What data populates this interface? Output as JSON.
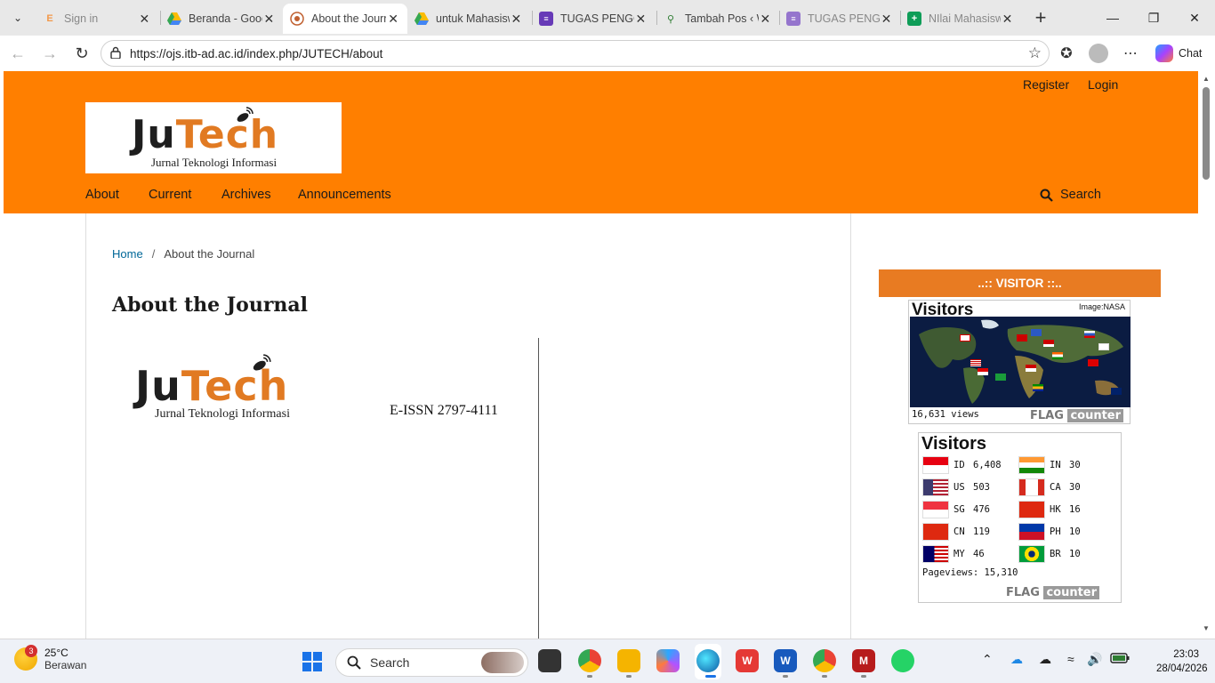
{
  "browser": {
    "tabs": [
      {
        "title": "Sign in",
        "icon": "E",
        "icon_color": "#f2994a",
        "active": false
      },
      {
        "title": "Beranda - Goog",
        "icon": "drive",
        "icon_color": "#34a853",
        "active": false
      },
      {
        "title": "About the Journ",
        "icon": "ojs",
        "icon_color": "#c06030",
        "active": true
      },
      {
        "title": "untuk Mahasisw",
        "icon": "drive",
        "icon_color": "#34a853",
        "active": false
      },
      {
        "title": "TUGAS PENGG/",
        "icon": "forms",
        "icon_color": "#673ab7",
        "active": false
      },
      {
        "title": "Tambah Pos ‹ W",
        "icon": "pin",
        "icon_color": "#2e7d32",
        "active": false
      },
      {
        "title": "TUGAS PENGG/",
        "icon": "forms",
        "icon_color": "#9575cd",
        "active": false
      },
      {
        "title": "NIlai Mahasisw",
        "icon": "sheets",
        "icon_color": "#0f9d58",
        "active": false
      }
    ],
    "url": "https://ojs.itb-ad.ac.id/index.php/JUTECH/about",
    "chat_label": "Chat"
  },
  "site": {
    "user_nav": {
      "register": "Register",
      "login": "Login"
    },
    "logo": {
      "ju": "Ju",
      "tech": "Tech",
      "subtitle": "Jurnal Teknologi Informasi"
    },
    "primary_nav": [
      "About",
      "Current",
      "Archives",
      "Announcements"
    ],
    "search_label": "Search"
  },
  "main": {
    "breadcrumb": {
      "home": "Home",
      "separator": "/",
      "current": "About the Journal"
    },
    "title": "About the Journal",
    "issn": "E-ISSN 2797-4111"
  },
  "sidebar": {
    "visitor_header": "..:: VISITOR ::..",
    "flag_map": {
      "title": "Visitors",
      "credit": "Image:NASA",
      "views": "16,631 views"
    },
    "flag_list": {
      "title": "Visitors",
      "rows": [
        {
          "code": "ID",
          "count": "6,408"
        },
        {
          "code": "US",
          "count": "503"
        },
        {
          "code": "SG",
          "count": "476"
        },
        {
          "code": "CN",
          "count": "119"
        },
        {
          "code": "MY",
          "count": "46"
        },
        {
          "code": "IN",
          "count": "30"
        },
        {
          "code": "CA",
          "count": "30"
        },
        {
          "code": "HK",
          "count": "16"
        },
        {
          "code": "PH",
          "count": "10"
        },
        {
          "code": "BR",
          "count": "10"
        }
      ],
      "pageviews": "Pageviews: 15,310"
    },
    "flagcounter": {
      "flag": "FLAG",
      "counter": "counter"
    }
  },
  "taskbar": {
    "weather": {
      "temp": "25°C",
      "desc": "Berawan",
      "badge": "3"
    },
    "search_label": "Search",
    "time": "23:03",
    "date": "28/04/2026"
  }
}
